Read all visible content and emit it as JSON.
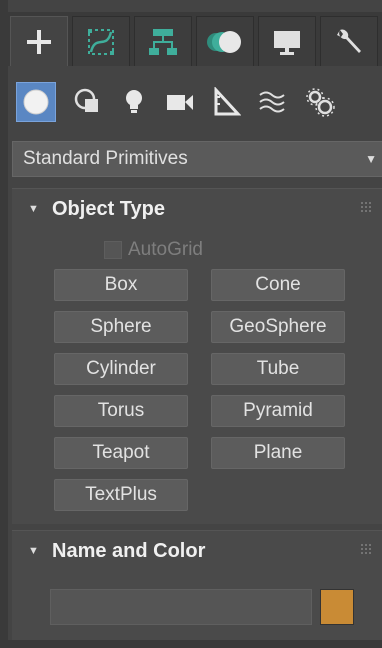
{
  "main_tabs": [
    {
      "icon": "create-plus-icon",
      "active": true
    },
    {
      "icon": "modify-curve-icon",
      "active": false
    },
    {
      "icon": "hierarchy-icon",
      "active": false
    },
    {
      "icon": "motion-icon",
      "active": false
    },
    {
      "icon": "display-monitor-icon",
      "active": false
    },
    {
      "icon": "utilities-wrench-icon",
      "active": false
    }
  ],
  "sub_tabs": [
    {
      "icon": "geometry-sphere-icon",
      "active": true
    },
    {
      "icon": "shapes-icon",
      "active": false
    },
    {
      "icon": "lights-bulb-icon",
      "active": false
    },
    {
      "icon": "cameras-icon",
      "active": false
    },
    {
      "icon": "helpers-ruler-icon",
      "active": false
    },
    {
      "icon": "space-warps-icon",
      "active": false
    },
    {
      "icon": "systems-gears-icon",
      "active": false
    }
  ],
  "dropdown": {
    "value": "Standard Primitives"
  },
  "object_type": {
    "title": "Object Type",
    "autogrid_label": "AutoGrid",
    "buttons": [
      "Box",
      "Cone",
      "Sphere",
      "GeoSphere",
      "Cylinder",
      "Tube",
      "Torus",
      "Pyramid",
      "Teapot",
      "Plane",
      "TextPlus"
    ]
  },
  "name_and_color": {
    "title": "Name and Color",
    "name_value": "",
    "color": "#c98b35"
  },
  "colors": {
    "accent": "#5a87c3",
    "panel": "#4a4a4a"
  }
}
